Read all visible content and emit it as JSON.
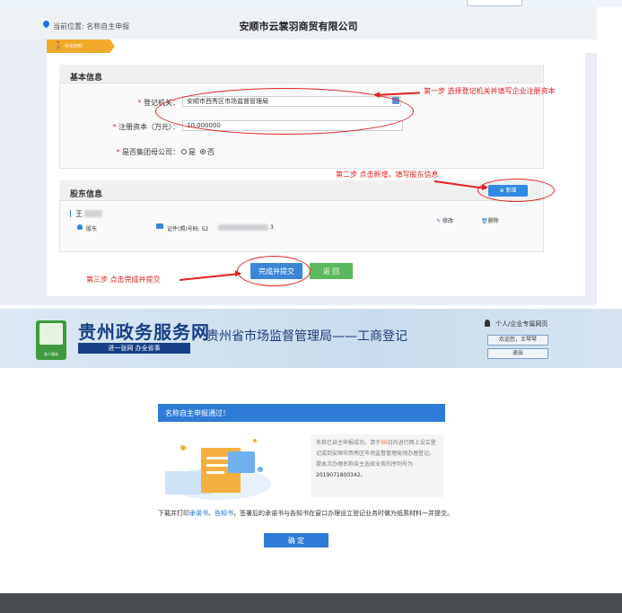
{
  "top": {
    "breadcrumb": "当前位置: 名称自主申报",
    "company_title": "安顺市云裳羽商贸有限公司",
    "tab_label": "补充材料",
    "basic_section": {
      "title": "基本信息",
      "registration_authority": {
        "label": "登记机关：",
        "value": "安顺市西秀区市场监督管理局"
      },
      "registered_capital": {
        "label": "注册资本（万元）：",
        "value": "10.000000"
      },
      "group_parent": {
        "label": "是否集团母公司：",
        "options": [
          "是",
          "否"
        ],
        "selected": "否"
      }
    },
    "shareholder_section": {
      "title": "股东信息",
      "add_button": "新增",
      "shareholder": {
        "name_prefix": "王",
        "role": "股东",
        "id_label": "证件(照)号码: 52",
        "id_suffix": "3",
        "edit": "修改",
        "delete": "删除"
      }
    },
    "submit_button": "完成并提交",
    "back_button": "返 回",
    "annotations": {
      "step1": "第一步 选择登记机关并填写企业注册资本",
      "step2": "第二步 点击新增，填写股东信息",
      "step3": "第三步 点击完成并提交"
    },
    "annotation_color": "#e02020"
  },
  "bottom": {
    "portal_title": "贵州政务服务网",
    "portal_slogan": "进一张网 办全省事",
    "logo_label": "贵人服务",
    "portal_subtitle": "贵州省市场监督管理局——工商登记",
    "user_home": "个人/企业专属网页",
    "welcome_button": "欢迎您，王琴琴",
    "logout_button": "退出",
    "success_title": "名称自主申报通过！",
    "notice": {
      "part1": "名称已自主申报成功，请于",
      "days": "30",
      "part2": "日内进行网上设立登记或到安顺市西秀区市场监督管理局领办理登记。提本次办理名称自主选择业务的序列号为",
      "serial": "2019071800342",
      "end": "。"
    },
    "download": {
      "prefix": "下载并打印",
      "link1": "承诺书",
      "sep": "、",
      "link2": "告知书",
      "rest": "，签署后的承诺书与告知书在窗口办理设立登记业务时做为纸质材料一并提交。"
    },
    "confirm_button": "确 定",
    "brand_color": "#2f7bd8"
  }
}
